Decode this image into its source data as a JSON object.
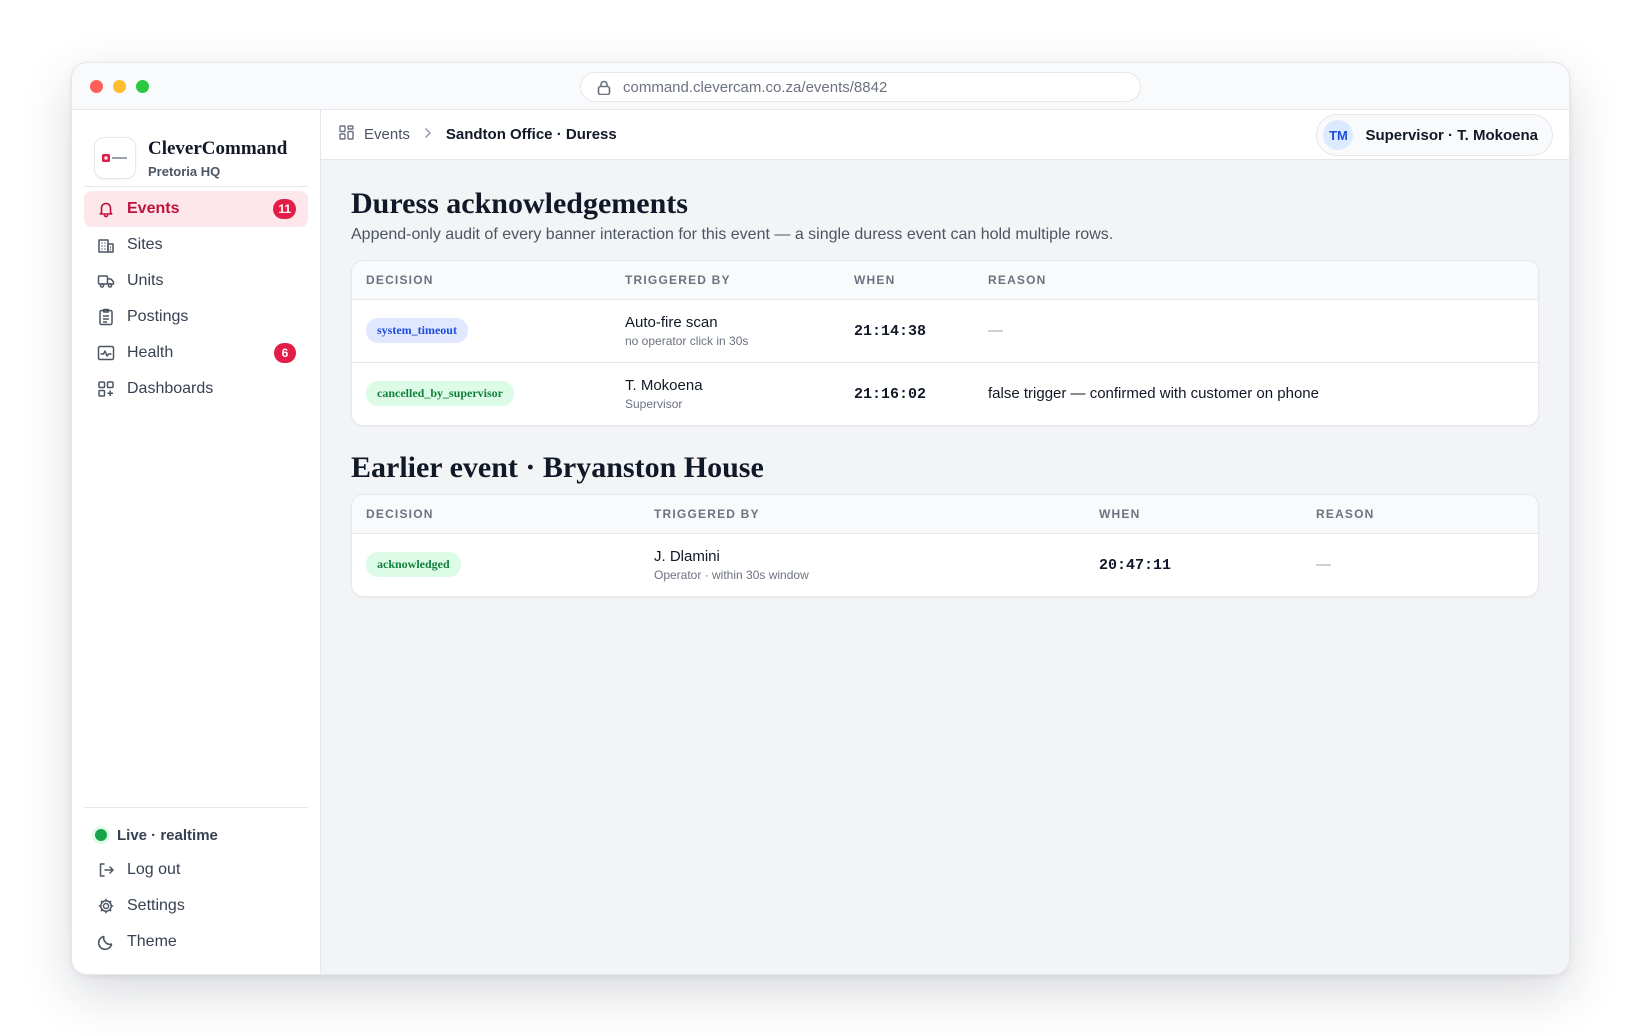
{
  "browser": {
    "url": "command.clevercam.co.za/events/8842"
  },
  "brand": {
    "name": "CleverCommand",
    "subtitle": "Pretoria HQ"
  },
  "nav": {
    "items": [
      {
        "label": "Events",
        "icon": "bell-icon",
        "badge": "11",
        "active": true
      },
      {
        "label": "Sites",
        "icon": "building-icon"
      },
      {
        "label": "Units",
        "icon": "truck-icon"
      },
      {
        "label": "Postings",
        "icon": "clipboard-icon"
      },
      {
        "label": "Health",
        "icon": "activity-icon",
        "badge": "6"
      },
      {
        "label": "Dashboards",
        "icon": "dashboard-grid-icon"
      }
    ]
  },
  "sidebar_bottom": {
    "status": "Live · realtime",
    "logout": "Log out",
    "settings": "Settings",
    "theme": "Theme"
  },
  "topbar": {
    "crumb_root": "Events",
    "crumb_current": "Sandton Office · Duress",
    "user_initials": "TM",
    "user_name": "Supervisor · T. Mokoena"
  },
  "section1": {
    "title": "Duress acknowledgements",
    "subtitle": "Append-only audit of every banner interaction for this event — a single duress event can hold multiple rows.",
    "columns": [
      "DECISION",
      "TRIGGERED BY",
      "WHEN",
      "REASON"
    ],
    "rows": [
      {
        "decision": "system_timeout",
        "triggered_by": "Auto-fire scan",
        "triggered_sub": "no operator click in 30s",
        "when": "21:14:38",
        "reason": "—"
      },
      {
        "decision": "cancelled_by_supervisor",
        "triggered_by": "T. Mokoena",
        "triggered_sub": "Supervisor",
        "when": "21:16:02",
        "reason": "false trigger — confirmed with customer on phone"
      }
    ]
  },
  "section2": {
    "title": "Earlier event · Bryanston House",
    "columns": [
      "DECISION",
      "TRIGGERED BY",
      "WHEN",
      "REASON"
    ],
    "rows": [
      {
        "decision": "acknowledged",
        "triggered_by": "J. Dlamini",
        "triggered_sub": "Operator · within 30s window",
        "when": "20:47:11",
        "reason": "—"
      }
    ]
  },
  "colors": {
    "accent": "#e11d48",
    "active_bg": "#fde7ea",
    "live": "#16a34a"
  }
}
